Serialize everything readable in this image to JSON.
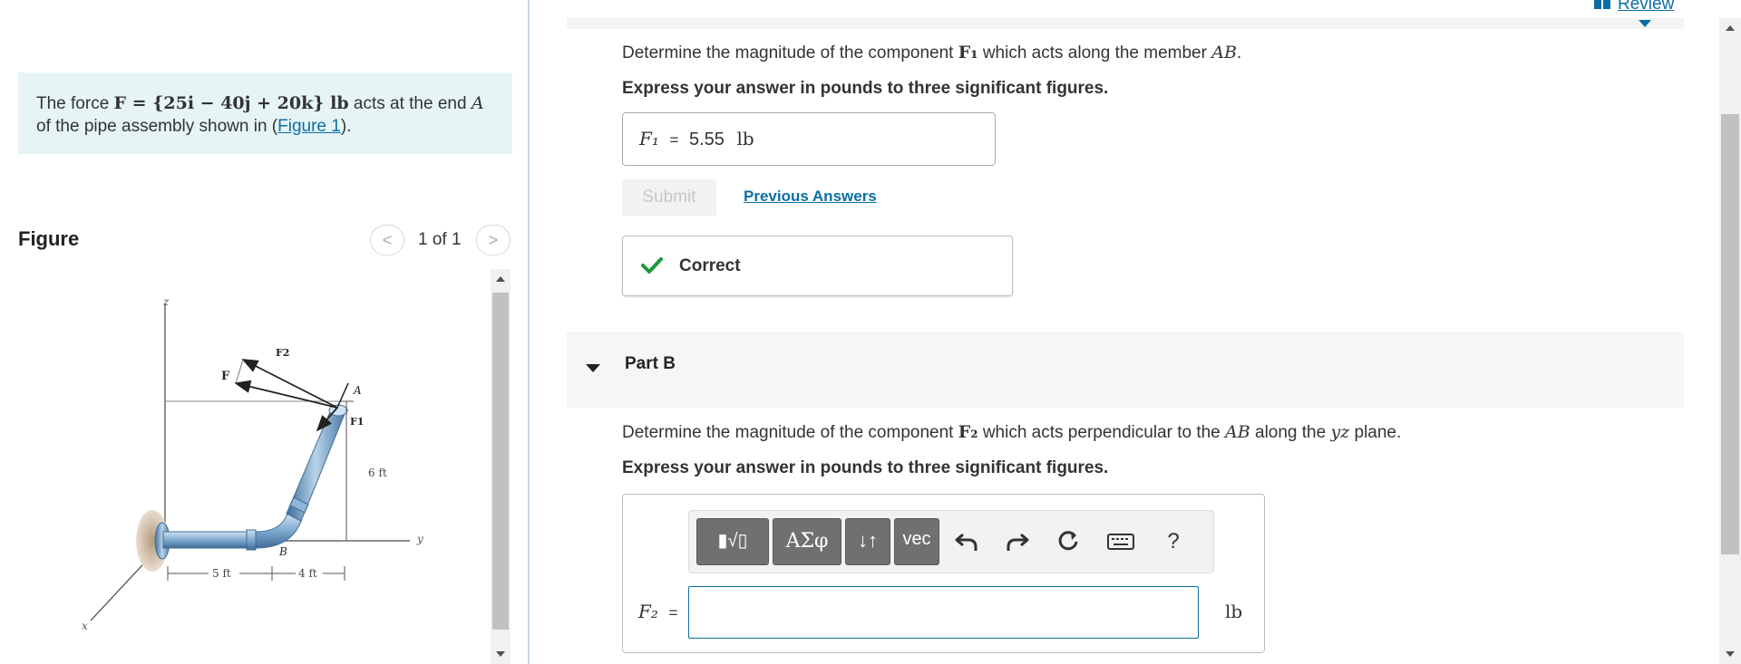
{
  "problem": {
    "prefix": "The force ",
    "force_expr": "F = {25i − 40j + 20k}  lb",
    "middle": " acts at the end ",
    "point": "A",
    "line2_prefix": "of the pipe assembly shown in (",
    "figure_link": "Figure 1",
    "line2_suffix": ")."
  },
  "figure": {
    "title": "Figure",
    "counter": "1 of 1",
    "prev_glyph": "<",
    "next_glyph": ">",
    "labels": {
      "z": "z",
      "x": "x",
      "y": "y",
      "F": "F",
      "F2": "F2",
      "F1": "F1",
      "A": "A",
      "B": "B",
      "dim_6ft": "6 ft",
      "dim_5ft": "5 ft",
      "dim_4ft": "4 ft"
    }
  },
  "header": {
    "review_label": "Review"
  },
  "part_a": {
    "question_prefix": "Determine the magnitude of the component ",
    "question_symbol": "F₁",
    "question_middle": " which acts along the member ",
    "question_member": "AB",
    "question_suffix": ".",
    "instruction": "Express your answer in pounds to three significant figures.",
    "answer_symbol": "F₁",
    "answer_equals": "=",
    "answer_value": "5.55",
    "answer_unit": "lb",
    "submit_label": "Submit",
    "previous_answers_label": "Previous Answers",
    "result_label": "Correct"
  },
  "part_b": {
    "label": "Part B",
    "question_prefix": "Determine the magnitude of the component ",
    "question_symbol": "F₂",
    "question_middle": " which acts perpendicular to the ",
    "question_member": "AB",
    "question_middle2": " along the ",
    "question_plane": "yz",
    "question_suffix": " plane.",
    "instruction": "Express your answer in pounds to three significant figures.",
    "answer_symbol": "F₂",
    "answer_equals": "=",
    "answer_value": "",
    "answer_unit": "lb",
    "toolbar": {
      "templates_glyph": "▮√▯",
      "greek_glyph": "ΑΣφ",
      "arrows_glyph": "↓↑",
      "vec_label": "vec",
      "help_glyph": "?"
    }
  },
  "colors": {
    "accent": "#0b6fa4",
    "correct_green": "#1a9a3c",
    "problem_bg": "#e6f4f5",
    "toolbar_button": "#707070"
  }
}
